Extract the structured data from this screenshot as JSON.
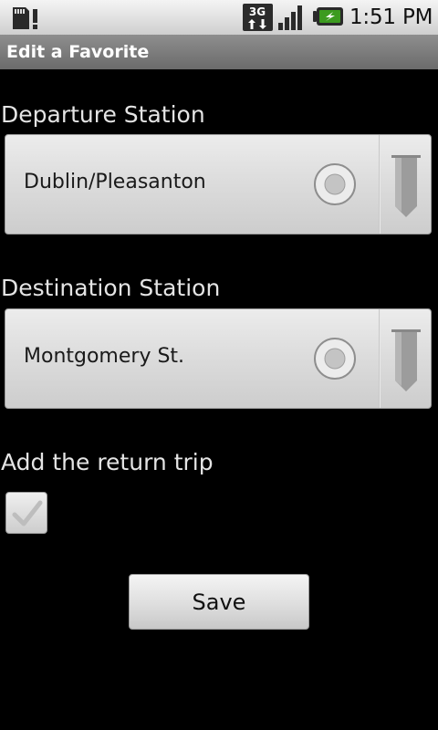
{
  "status_bar": {
    "network": "3G",
    "time": "1:51 PM",
    "icons": [
      "sd-card-icon",
      "3g-data-icon",
      "signal-icon",
      "battery-charging-icon"
    ]
  },
  "title_bar": {
    "title": "Edit a Favorite"
  },
  "departure": {
    "label": "Departure Station",
    "value": "Dublin/Pleasanton"
  },
  "destination": {
    "label": "Destination Station",
    "value": "Montgomery St."
  },
  "return_trip": {
    "label": "Add the return trip",
    "checked": false
  },
  "actions": {
    "save_label": "Save"
  },
  "colors": {
    "background": "#000000",
    "title_bar": "#7a7a7a",
    "label_text": "#e4e4e4",
    "battery_accent": "#3c9b1f"
  }
}
